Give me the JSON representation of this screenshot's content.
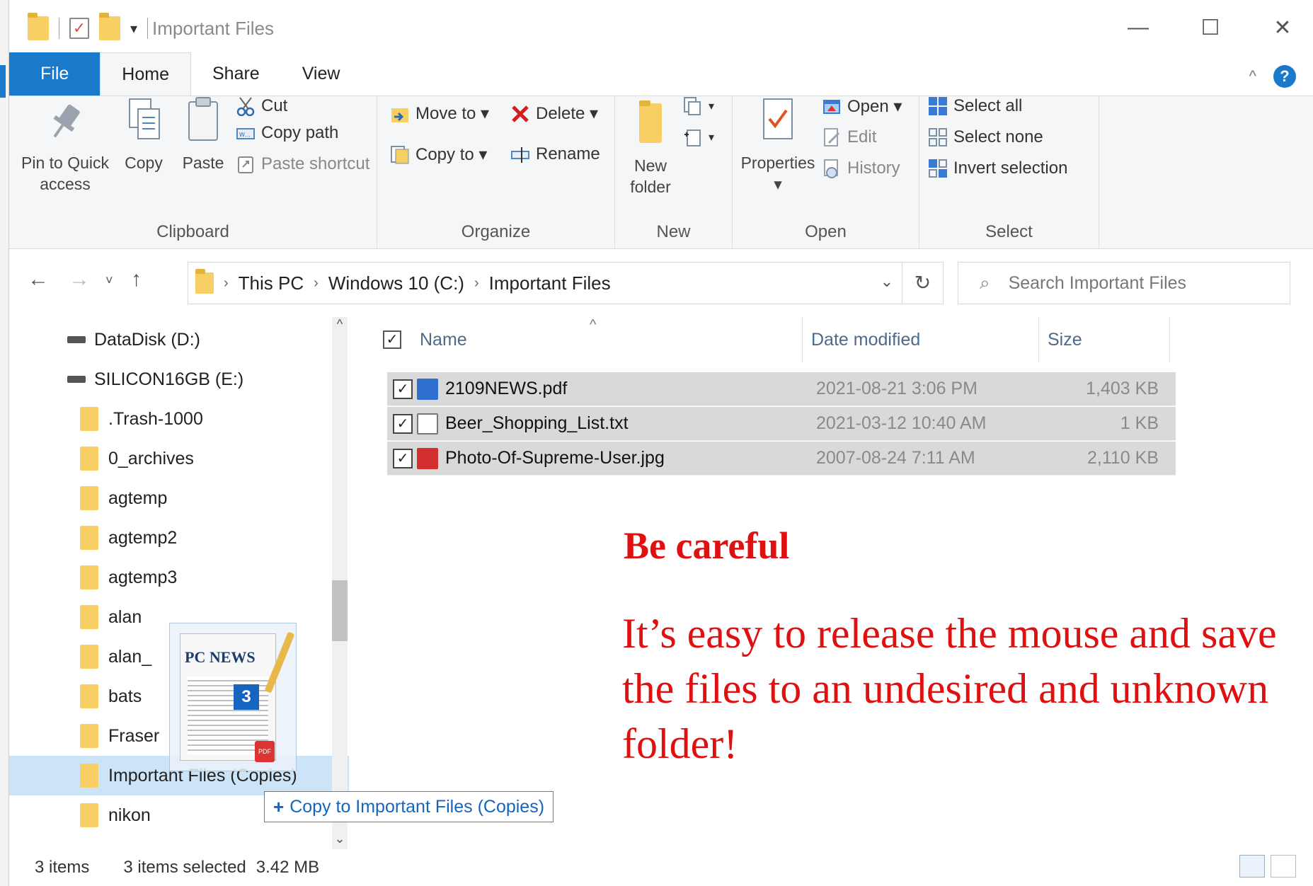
{
  "window": {
    "title": "Important Files",
    "controls": {
      "minimize": "—",
      "maximize": "☐",
      "close": "✕"
    }
  },
  "ribbon_tabs": [
    "File",
    "Home",
    "Share",
    "View"
  ],
  "ribbon": {
    "clipboard": {
      "pin_line1": "Pin to Quick",
      "pin_line2": "access",
      "copy": "Copy",
      "paste": "Paste",
      "cut": "Cut",
      "copy_path": "Copy path",
      "paste_shortcut": "Paste shortcut",
      "label": "Clipboard"
    },
    "organize": {
      "move_to": "Move to ▾",
      "copy_to": "Copy to ▾",
      "delete": "Delete ▾",
      "rename": "Rename",
      "label": "Organize"
    },
    "new": {
      "new_folder_line1": "New",
      "new_folder_line2": "folder",
      "label": "New"
    },
    "open": {
      "properties": "Properties",
      "properties_arrow": "▾",
      "open": "Open ▾",
      "edit": "Edit",
      "history": "History",
      "label": "Open"
    },
    "select": {
      "select_all": "Select all",
      "select_none": "Select none",
      "invert_selection": "Invert selection",
      "label": "Select"
    }
  },
  "address": {
    "crumbs": [
      "This PC",
      "Windows 10 (C:)",
      "Important Files"
    ],
    "search_placeholder": "Search Important Files"
  },
  "nav_pane": {
    "drives": [
      "DataDisk (D:)",
      "SILICON16GB (E:)"
    ],
    "folders": [
      ".Trash-1000",
      "0_archives",
      "agtemp",
      "agtemp2",
      "agtemp3",
      "alan",
      "alan_",
      "bats",
      "Fraser",
      "Important Files (Copies)",
      "nikon"
    ]
  },
  "file_list": {
    "columns": {
      "name": "Name",
      "date": "Date modified",
      "size": "Size"
    },
    "files": [
      {
        "name": "2109NEWS.pdf",
        "date": "2021-08-21 3:06 PM",
        "size": "1,403 KB",
        "icon": "pdf-icon",
        "color": "#2f6fd0"
      },
      {
        "name": "Beer_Shopping_List.txt",
        "date": "2021-03-12 10:40 AM",
        "size": "1 KB",
        "icon": "txt-icon",
        "color": "#e0b030"
      },
      {
        "name": "Photo-Of-Supreme-User.jpg",
        "date": "2007-08-24 7:11 AM",
        "size": "2,110 KB",
        "icon": "jpg-icon",
        "color": "#d32f2f"
      }
    ]
  },
  "annotation": {
    "title": "Be careful",
    "body": "It’s easy to release the mouse and save the files to an undesired and unknown folder!",
    "color": "#e01010"
  },
  "drag": {
    "masthead": "PC NEWS",
    "count": "3",
    "tooltip": "Copy to Important Files (Copies)",
    "pdf_badge": "PDF"
  },
  "status": {
    "items": "3 items",
    "selected": "3 items selected",
    "size": "3.42 MB"
  }
}
